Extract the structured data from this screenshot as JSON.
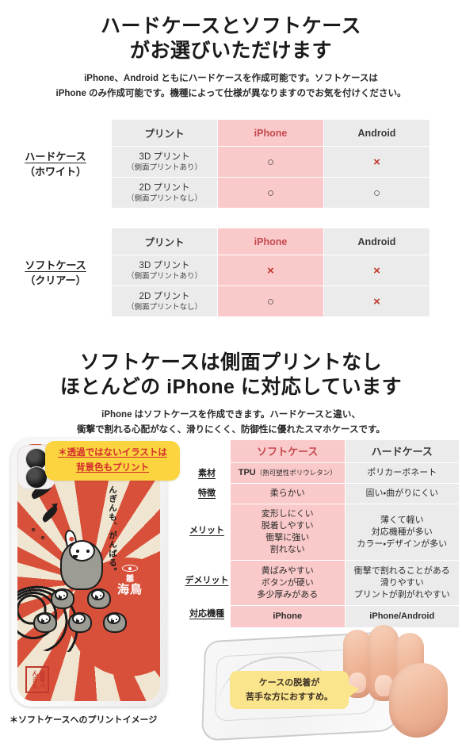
{
  "section_one": {
    "title_line1": "ハードケースとソフトケース",
    "title_line2": "がお選びいただけます",
    "lead_line1": "iPhone、Android ともにハードケースを作成可能です。ソフトケースは",
    "lead_line2": "iPhone のみ作成可能です。機種によって仕様が異なりますのでお気を付けください。"
  },
  "table_hard": {
    "row_label_main": "ハードケース",
    "row_label_sub": "（ホワイト）",
    "headers": [
      "プリント",
      "iPhone",
      "Android"
    ],
    "rows": [
      {
        "print_main": "3D プリント",
        "print_sub": "（側面プリントあり）",
        "iphone": "○",
        "android": "×"
      },
      {
        "print_main": "2D プリント",
        "print_sub": "（側面プリントなし）",
        "iphone": "○",
        "android": "○"
      }
    ]
  },
  "table_soft": {
    "row_label_main": "ソフトケース",
    "row_label_sub": "（クリアー）",
    "headers": [
      "プリント",
      "iPhone",
      "Android"
    ],
    "rows": [
      {
        "print_main": "3D プリント",
        "print_sub": "（側面プリントあり）",
        "iphone": "×",
        "android": "×"
      },
      {
        "print_main": "2D プリント",
        "print_sub": "（側面プリントなし）",
        "iphone": "○",
        "android": "×"
      }
    ]
  },
  "section_two": {
    "title_line1": "ソフトケースは側面プリントなし",
    "title_line2": "ほとんどの iPhone に対応しています",
    "lead_line1": "iPhone はソフトケースを作成できます。ハードケースと違い、",
    "lead_line2": "衝撃で割れる心配がなく、滑りにくく、防御性に優れたスマホケースです。"
  },
  "phone_callout": {
    "line1": "＊透過ではないイラストは",
    "line2": "背景色もプリント"
  },
  "phone_art": {
    "vertical_text": "んぎんも、がんばる。",
    "brand_small": "雛",
    "brand_large": "海鳥",
    "seal_text": "皇帝ぺんぎん"
  },
  "spec_table": {
    "headers": [
      "",
      "ソフトケース",
      "ハードケース"
    ],
    "labels": [
      "素材",
      "特徴",
      "メリット",
      "デメリット",
      "対応機種"
    ],
    "rows": [
      {
        "label": "素材",
        "soft": "TPU（熱可塑性ポリウレタン）",
        "soft_main": "TPU",
        "soft_sub": "（熱可塑性ポリウレタン）",
        "hard": "ポリカーボネート"
      },
      {
        "label": "特徴",
        "soft": "柔らかい",
        "hard": "固い・曲がりにくい"
      },
      {
        "label": "メリット",
        "soft": "変形しにくい\n脱着しやすい\n衝撃に強い\n割れない",
        "soft_lines": [
          "変形しにくい",
          "脱着しやすい",
          "衝撃に強い",
          "割れない"
        ],
        "hard_lines": [
          "薄くて軽い",
          "対応機種が多い",
          "カラー・デザインが多い"
        ]
      },
      {
        "label": "デメリット",
        "soft_lines": [
          "黄ばみやすい",
          "ボタンが硬い",
          "多少厚みがある"
        ],
        "hard_lines": [
          "衝撃で割れることがある",
          "滑りやすい",
          "プリントが剥がれやすい"
        ]
      },
      {
        "label": "対応機種",
        "soft": "iPhone",
        "hard": "iPhone/Android"
      }
    ]
  },
  "speech_bubble": {
    "line1": "ケースの脱着が",
    "line2": "苦手な方におすすめ。"
  },
  "footer_note": "＊ソフトケースへのプリントイメージ",
  "colors": {
    "pink_cell": "#fac9c9",
    "gray_cell": "#ebebeb",
    "pink_text": "#c6494f",
    "cross_red": "#c0392b",
    "callout_yellow": "#fbd43f",
    "bubble_yellow": "#fbe58c",
    "art_red": "#d9503a"
  }
}
